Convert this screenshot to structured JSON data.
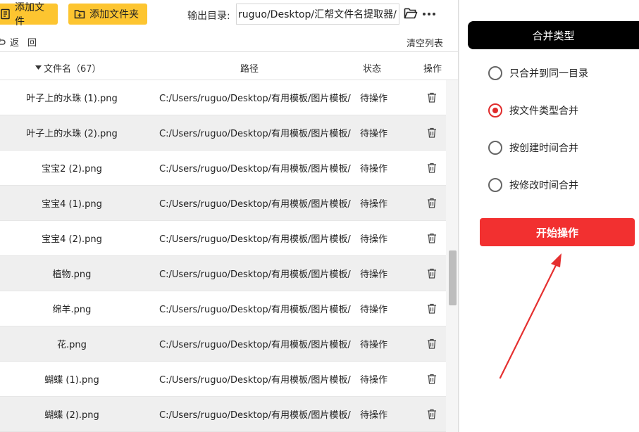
{
  "toolbar": {
    "add_file": "添加文件",
    "add_folder": "添加文件夹",
    "output_label": "输出目录:",
    "output_path": "/ruguo/Desktop/汇帮文件名提取器",
    "folder_icon": "folder-open-icon",
    "more_icon": "more-dots-icon"
  },
  "subbar": {
    "back": "返回",
    "clear": "清空列表"
  },
  "table": {
    "headers": {
      "name": "文件名（67）",
      "path": "路径",
      "status": "状态",
      "op": "操作"
    },
    "rows": [
      {
        "name": "叶子上的水珠 (1).png",
        "path": "C:/Users/ruguo/Desktop/有用模板/图片模板/",
        "status": "待操作"
      },
      {
        "name": "叶子上的水珠 (2).png",
        "path": "C:/Users/ruguo/Desktop/有用模板/图片模板/",
        "status": "待操作"
      },
      {
        "name": "宝宝2 (2).png",
        "path": "C:/Users/ruguo/Desktop/有用模板/图片模板/",
        "status": "待操作"
      },
      {
        "name": "宝宝4 (1).png",
        "path": "C:/Users/ruguo/Desktop/有用模板/图片模板/",
        "status": "待操作"
      },
      {
        "name": "宝宝4 (2).png",
        "path": "C:/Users/ruguo/Desktop/有用模板/图片模板/",
        "status": "待操作"
      },
      {
        "name": "植物.png",
        "path": "C:/Users/ruguo/Desktop/有用模板/图片模板/",
        "status": "待操作"
      },
      {
        "name": "绵羊.png",
        "path": "C:/Users/ruguo/Desktop/有用模板/图片模板/",
        "status": "待操作"
      },
      {
        "name": "花.png",
        "path": "C:/Users/ruguo/Desktop/有用模板/图片模板/",
        "status": "待操作"
      },
      {
        "name": "蝴蝶 (1).png",
        "path": "C:/Users/ruguo/Desktop/有用模板/图片模板/",
        "status": "待操作"
      },
      {
        "name": "蝴蝶 (2).png",
        "path": "C:/Users/ruguo/Desktop/有用模板/图片模板/",
        "status": "待操作"
      }
    ]
  },
  "merge": {
    "title": "合并类型",
    "options": [
      {
        "label": "只合并到同一目录",
        "selected": false
      },
      {
        "label": "按文件类型合并",
        "selected": true
      },
      {
        "label": "按创建时间合并",
        "selected": false
      },
      {
        "label": "按修改时间合并",
        "selected": false
      }
    ],
    "start": "开始操作"
  },
  "colors": {
    "toolbar_button": "#fdc530",
    "accent_red": "#f23030",
    "header_black": "#000000",
    "row_alt": "#efefef"
  }
}
